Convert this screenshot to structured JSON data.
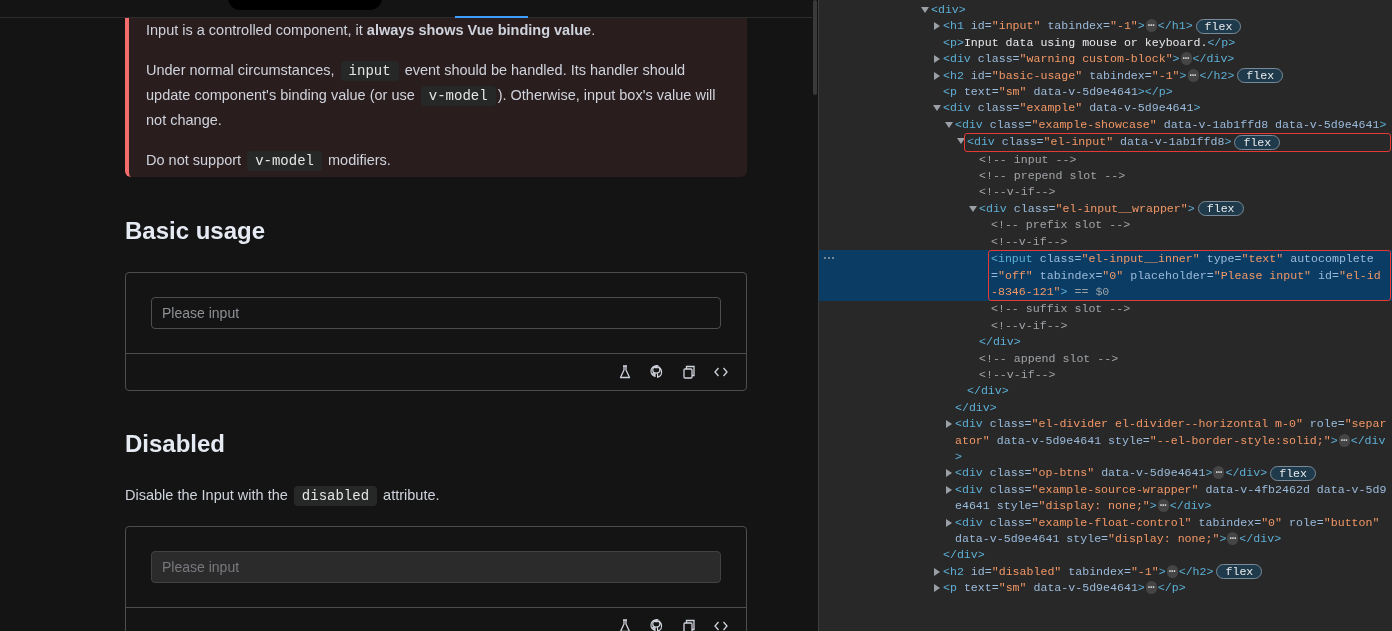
{
  "docs": {
    "warning": {
      "paragraphs": [
        [
          {
            "kind": "text",
            "text": "Input is a controlled component, it **always shows Vue binding value**."
          }
        ],
        [
          {
            "kind": "text",
            "text": "Under normal circumstances, "
          },
          {
            "kind": "code",
            "text": "input"
          },
          {
            "kind": "text",
            "text": " event should be handled. Its handler should update component's binding value (or use "
          },
          {
            "kind": "code",
            "text": "v-model"
          },
          {
            "kind": "text",
            "text": "). Otherwise, input box's value will not change."
          }
        ],
        [
          {
            "kind": "text",
            "text": "Do not support "
          },
          {
            "kind": "code",
            "text": "v-model"
          },
          {
            "kind": "text",
            "text": " modifiers."
          }
        ]
      ]
    },
    "sections": [
      {
        "heading": "Basic usage",
        "example": {
          "input": {
            "placeholder": "Please input",
            "disabled": false
          }
        }
      },
      {
        "heading": "Disabled",
        "description": [
          {
            "kind": "text",
            "text": "Disable the Input with the "
          },
          {
            "kind": "code",
            "text": "disabled"
          },
          {
            "kind": "text",
            "text": " attribute."
          }
        ],
        "example": {
          "input": {
            "placeholder": "Please input",
            "disabled": true
          }
        }
      }
    ]
  },
  "elements_tree": {
    "nodes": [
      {
        "expanded": true,
        "selected": false,
        "annotated": false,
        "tokens": [
          {
            "kind": "tag",
            "text": "<div>"
          }
        ],
        "children": [
          {
            "expanded": false,
            "selected": false,
            "annotated": false,
            "tokens": [
              {
                "kind": "tag",
                "text": "<h1"
              },
              {
                "kind": "attr",
                "text": " id="
              },
              {
                "kind": "value",
                "text": "\"input\""
              },
              {
                "kind": "attr",
                "text": " tabindex="
              },
              {
                "kind": "value",
                "text": "\"-1\""
              },
              {
                "kind": "tag",
                "text": ">"
              },
              {
                "kind": "ellipsis",
                "text": "⋯"
              },
              {
                "kind": "tag",
                "text": "</h1>"
              },
              {
                "kind": "badge",
                "text": "flex"
              }
            ]
          },
          {
            "selected": false,
            "annotated": false,
            "tokens": [
              {
                "kind": "tag",
                "text": "<p>"
              },
              {
                "kind": "text",
                "text": "Input data using mouse or keyboard."
              },
              {
                "kind": "tag",
                "text": "</p>"
              }
            ]
          },
          {
            "expanded": false,
            "selected": false,
            "annotated": false,
            "tokens": [
              {
                "kind": "tag",
                "text": "<div"
              },
              {
                "kind": "attr",
                "text": " class="
              },
              {
                "kind": "value",
                "text": "\"warning custom-block\""
              },
              {
                "kind": "tag",
                "text": ">"
              },
              {
                "kind": "ellipsis",
                "text": "⋯"
              },
              {
                "kind": "tag",
                "text": "</div>"
              }
            ]
          },
          {
            "expanded": false,
            "selected": false,
            "annotated": false,
            "tokens": [
              {
                "kind": "tag",
                "text": "<h2"
              },
              {
                "kind": "attr",
                "text": " id="
              },
              {
                "kind": "value",
                "text": "\"basic-usage\""
              },
              {
                "kind": "attr",
                "text": " tabindex="
              },
              {
                "kind": "value",
                "text": "\"-1\""
              },
              {
                "kind": "tag",
                "text": ">"
              },
              {
                "kind": "ellipsis",
                "text": "⋯"
              },
              {
                "kind": "tag",
                "text": "</h2>"
              },
              {
                "kind": "badge",
                "text": "flex"
              }
            ]
          },
          {
            "selected": false,
            "annotated": false,
            "tokens": [
              {
                "kind": "tag",
                "text": "<p"
              },
              {
                "kind": "attr",
                "text": " text="
              },
              {
                "kind": "value",
                "text": "\"sm\""
              },
              {
                "kind": "attr",
                "text": " data-v-5d9e4641"
              },
              {
                "kind": "tag",
                "text": "></p>"
              }
            ]
          },
          {
            "expanded": true,
            "selected": false,
            "annotated": false,
            "tokens": [
              {
                "kind": "tag",
                "text": "<div"
              },
              {
                "kind": "attr",
                "text": " class="
              },
              {
                "kind": "value",
                "text": "\"example\""
              },
              {
                "kind": "attr",
                "text": " data-v-5d9e4641"
              },
              {
                "kind": "tag",
                "text": ">"
              }
            ],
            "closing": [
              {
                "kind": "tag",
                "text": "</div>"
              }
            ],
            "children": [
              {
                "expanded": true,
                "selected": false,
                "annotated": false,
                "tokens": [
                  {
                    "kind": "tag",
                    "text": "<div"
                  },
                  {
                    "kind": "attr",
                    "text": " class="
                  },
                  {
                    "kind": "value",
                    "text": "\"example-showcase\""
                  },
                  {
                    "kind": "attr",
                    "text": " data-v-1ab1ffd8 data-v-5d9e4641"
                  },
                  {
                    "kind": "tag",
                    "text": ">"
                  }
                ],
                "closing": [
                  {
                    "kind": "tag",
                    "text": "</div>"
                  }
                ],
                "children": [
                  {
                    "expanded": true,
                    "selected": false,
                    "annotated": true,
                    "tokens": [
                      {
                        "kind": "tag",
                        "text": "<div"
                      },
                      {
                        "kind": "attr",
                        "text": " class="
                      },
                      {
                        "kind": "value",
                        "text": "\"el-input\""
                      },
                      {
                        "kind": "attr",
                        "text": " data-v-1ab1ffd8"
                      },
                      {
                        "kind": "tag",
                        "text": ">"
                      },
                      {
                        "kind": "badge",
                        "text": "flex"
                      }
                    ],
                    "closing": [
                      {
                        "kind": "tag",
                        "text": "</div>"
                      }
                    ],
                    "children": [
                      {
                        "selected": false,
                        "annotated": false,
                        "tokens": [
                          {
                            "kind": "comment",
                            "text": "<!-- input -->"
                          }
                        ]
                      },
                      {
                        "selected": false,
                        "annotated": false,
                        "tokens": [
                          {
                            "kind": "comment",
                            "text": "<!-- prepend slot -->"
                          }
                        ]
                      },
                      {
                        "selected": false,
                        "annotated": false,
                        "tokens": [
                          {
                            "kind": "comment",
                            "text": "<!--v-if-->"
                          }
                        ]
                      },
                      {
                        "expanded": true,
                        "selected": false,
                        "annotated": false,
                        "tokens": [
                          {
                            "kind": "tag",
                            "text": "<div"
                          },
                          {
                            "kind": "attr",
                            "text": " class="
                          },
                          {
                            "kind": "value",
                            "text": "\"el-input__wrapper\""
                          },
                          {
                            "kind": "tag",
                            "text": ">"
                          },
                          {
                            "kind": "badge",
                            "text": "flex"
                          }
                        ],
                        "closing": [
                          {
                            "kind": "tag",
                            "text": "</div>"
                          }
                        ],
                        "children": [
                          {
                            "selected": false,
                            "annotated": false,
                            "tokens": [
                              {
                                "kind": "comment",
                                "text": "<!-- prefix slot -->"
                              }
                            ]
                          },
                          {
                            "selected": false,
                            "annotated": false,
                            "tokens": [
                              {
                                "kind": "comment",
                                "text": "<!--v-if-->"
                              }
                            ]
                          },
                          {
                            "selected": true,
                            "annotated": true,
                            "tokens": [
                              {
                                "kind": "tag",
                                "text": "<input"
                              },
                              {
                                "kind": "attr",
                                "text": " class="
                              },
                              {
                                "kind": "value",
                                "text": "\"el-input__inner\""
                              },
                              {
                                "kind": "attr",
                                "text": " type="
                              },
                              {
                                "kind": "value",
                                "text": "\"text\""
                              },
                              {
                                "kind": "attr",
                                "text": " autocomplete="
                              },
                              {
                                "kind": "value",
                                "text": "\"off\""
                              },
                              {
                                "kind": "attr",
                                "text": " tabindex="
                              },
                              {
                                "kind": "value",
                                "text": "\"0\""
                              },
                              {
                                "kind": "attr",
                                "text": " placeholder="
                              },
                              {
                                "kind": "value",
                                "text": "\"Please input\""
                              },
                              {
                                "kind": "attr",
                                "text": " id="
                              },
                              {
                                "kind": "value",
                                "text": "\"el-id-8346-121\""
                              },
                              {
                                "kind": "tag",
                                "text": ">"
                              },
                              {
                                "kind": "ref",
                                "text": " == $0"
                              }
                            ]
                          },
                          {
                            "selected": false,
                            "annotated": false,
                            "tokens": [
                              {
                                "kind": "comment",
                                "text": "<!-- suffix slot -->"
                              }
                            ]
                          },
                          {
                            "selected": false,
                            "annotated": false,
                            "tokens": [
                              {
                                "kind": "comment",
                                "text": "<!--v-if-->"
                              }
                            ]
                          }
                        ]
                      },
                      {
                        "selected": false,
                        "annotated": false,
                        "tokens": [
                          {
                            "kind": "comment",
                            "text": "<!-- append slot -->"
                          }
                        ]
                      },
                      {
                        "selected": false,
                        "annotated": false,
                        "tokens": [
                          {
                            "kind": "comment",
                            "text": "<!--v-if-->"
                          }
                        ]
                      }
                    ]
                  }
                ]
              },
              {
                "expanded": false,
                "selected": false,
                "annotated": false,
                "tokens": [
                  {
                    "kind": "tag",
                    "text": "<div"
                  },
                  {
                    "kind": "attr",
                    "text": " class="
                  },
                  {
                    "kind": "value",
                    "text": "\"el-divider el-divider--horizontal m-0\""
                  },
                  {
                    "kind": "attr",
                    "text": " role="
                  },
                  {
                    "kind": "value",
                    "text": "\"separator\""
                  },
                  {
                    "kind": "attr",
                    "text": " data-v-5d9e4641"
                  },
                  {
                    "kind": "attr",
                    "text": " style="
                  },
                  {
                    "kind": "value",
                    "text": "\"--el-border-style:solid;\""
                  },
                  {
                    "kind": "tag",
                    "text": ">"
                  },
                  {
                    "kind": "ellipsis",
                    "text": "⋯"
                  },
                  {
                    "kind": "tag",
                    "text": "</div>"
                  }
                ]
              },
              {
                "expanded": false,
                "selected": false,
                "annotated": false,
                "tokens": [
                  {
                    "kind": "tag",
                    "text": "<div"
                  },
                  {
                    "kind": "attr",
                    "text": " class="
                  },
                  {
                    "kind": "value",
                    "text": "\"op-btns\""
                  },
                  {
                    "kind": "attr",
                    "text": " data-v-5d9e4641"
                  },
                  {
                    "kind": "tag",
                    "text": ">"
                  },
                  {
                    "kind": "ellipsis",
                    "text": "⋯"
                  },
                  {
                    "kind": "tag",
                    "text": "</div>"
                  },
                  {
                    "kind": "badge",
                    "text": "flex"
                  }
                ]
              },
              {
                "expanded": false,
                "selected": false,
                "annotated": false,
                "tokens": [
                  {
                    "kind": "tag",
                    "text": "<div"
                  },
                  {
                    "kind": "attr",
                    "text": " class="
                  },
                  {
                    "kind": "value",
                    "text": "\"example-source-wrapper\""
                  },
                  {
                    "kind": "attr",
                    "text": " data-v-4fb2462d data-v-5d9e4641"
                  },
                  {
                    "kind": "attr",
                    "text": " style="
                  },
                  {
                    "kind": "value",
                    "text": "\"display: none;\""
                  },
                  {
                    "kind": "tag",
                    "text": ">"
                  },
                  {
                    "kind": "ellipsis",
                    "text": "⋯"
                  },
                  {
                    "kind": "tag",
                    "text": "</div>"
                  }
                ]
              },
              {
                "expanded": false,
                "selected": false,
                "annotated": false,
                "tokens": [
                  {
                    "kind": "tag",
                    "text": "<div"
                  },
                  {
                    "kind": "attr",
                    "text": " class="
                  },
                  {
                    "kind": "value",
                    "text": "\"example-float-control\""
                  },
                  {
                    "kind": "attr",
                    "text": " tabindex="
                  },
                  {
                    "kind": "value",
                    "text": "\"0\""
                  },
                  {
                    "kind": "attr",
                    "text": " role="
                  },
                  {
                    "kind": "value",
                    "text": "\"button\""
                  },
                  {
                    "kind": "attr",
                    "text": " data-v-5d9e4641"
                  },
                  {
                    "kind": "attr",
                    "text": " style="
                  },
                  {
                    "kind": "value",
                    "text": "\"display: none;\""
                  },
                  {
                    "kind": "tag",
                    "text": ">"
                  },
                  {
                    "kind": "ellipsis",
                    "text": "⋯"
                  },
                  {
                    "kind": "tag",
                    "text": "</div>"
                  }
                ]
              }
            ]
          },
          {
            "expanded": false,
            "selected": false,
            "annotated": false,
            "tokens": [
              {
                "kind": "tag",
                "text": "<h2"
              },
              {
                "kind": "attr",
                "text": " id="
              },
              {
                "kind": "value",
                "text": "\"disabled\""
              },
              {
                "kind": "attr",
                "text": " tabindex="
              },
              {
                "kind": "value",
                "text": "\"-1\""
              },
              {
                "kind": "tag",
                "text": ">"
              },
              {
                "kind": "ellipsis",
                "text": "⋯"
              },
              {
                "kind": "tag",
                "text": "</h2>"
              },
              {
                "kind": "badge",
                "text": "flex"
              }
            ]
          },
          {
            "expanded": false,
            "selected": false,
            "annotated": false,
            "tokens": [
              {
                "kind": "tag",
                "text": "<p"
              },
              {
                "kind": "attr",
                "text": " text="
              },
              {
                "kind": "value",
                "text": "\"sm\""
              },
              {
                "kind": "attr",
                "text": " data-v-5d9e4641"
              },
              {
                "kind": "tag",
                "text": ">"
              },
              {
                "kind": "ellipsis",
                "text": "⋯"
              },
              {
                "kind": "tag",
                "text": "</p>"
              }
            ]
          }
        ]
      }
    ]
  }
}
